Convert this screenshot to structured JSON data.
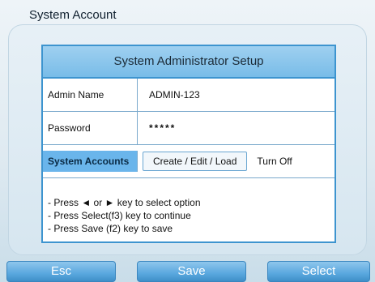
{
  "window": {
    "title": "System Account"
  },
  "dialog": {
    "title": "System Administrator Setup",
    "admin_name": {
      "label": "Admin Name",
      "value": "ADMIN-123"
    },
    "password": {
      "label": "Password",
      "value": "*****"
    },
    "system_accounts": {
      "label": "System Accounts",
      "create_button": "Create / Edit / Load",
      "turn_off": "Turn Off"
    },
    "help": [
      "- Press ◄ or  ► key to select option",
      "- Press Select(f3) key to continue",
      "- Press Save (f2) key to save"
    ]
  },
  "footer": {
    "esc": "Esc",
    "save": "Save",
    "select": "Select"
  },
  "colors": {
    "accent": "#3d94cf",
    "header": "#8cc8ef",
    "selected": "#6ab5eb"
  }
}
